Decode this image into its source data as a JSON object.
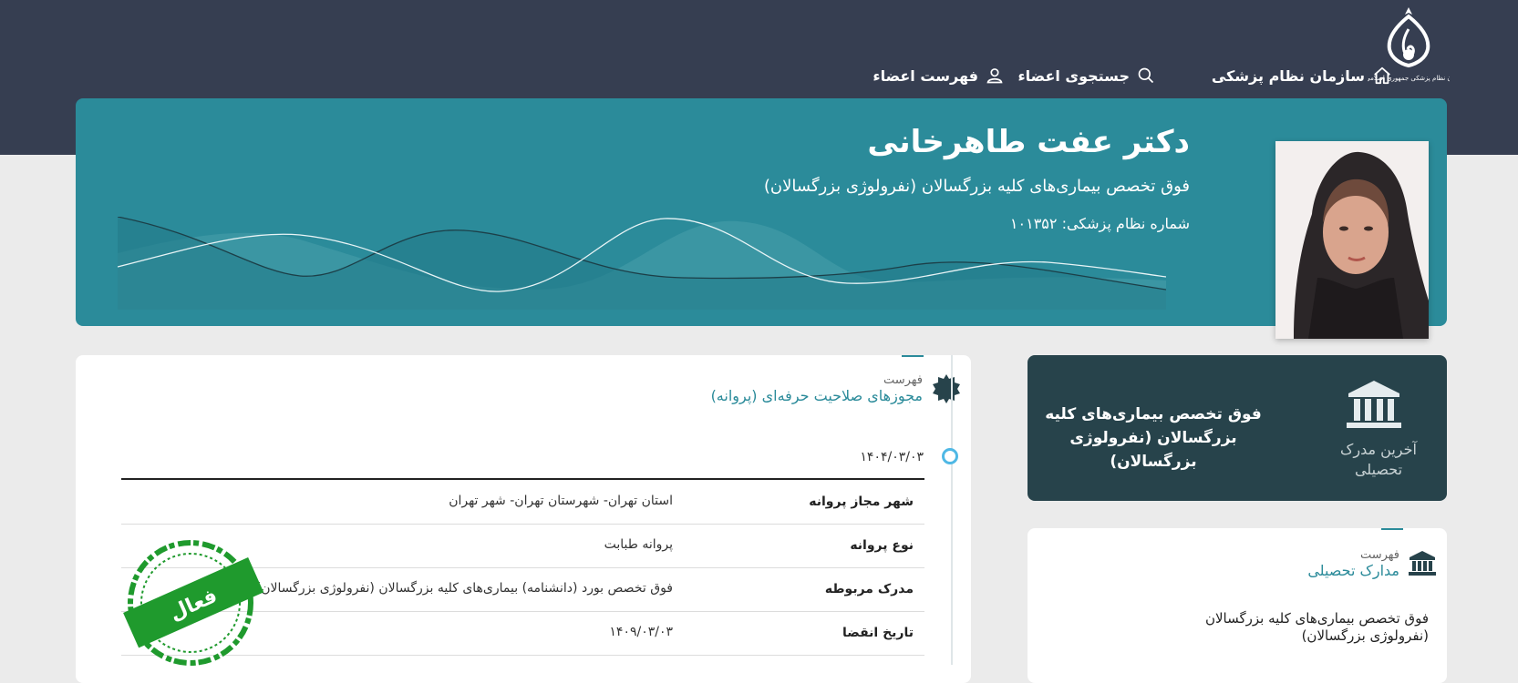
{
  "nav": {
    "home_label": "سازمان نظام پزشکی",
    "search_label": "جستجوی اعضاء",
    "members_label": "فهرست اعضاء",
    "logo_caption": "سازمان نظام پزشکی جمهوری اسلامی ایران"
  },
  "profile": {
    "name": "دکتر عفت طاهرخانی",
    "specialty": "فوق تخصص بیماری‌های کلیه بزرگسالان (نفرولوژی بزرگسالان)",
    "license_number_label": "شماره نظام پزشکی: ۱۰۱۳۵۲"
  },
  "latest_degree": {
    "label": "آخرین مدرک تحصیلی",
    "value": "فوق تخصص بیماری‌های کلیه بزرگسالان (نفرولوژی بزرگسالان)"
  },
  "license_section": {
    "small_title": "فهرست",
    "title": "مجوزهای صلاحیت حرفه‌ای (پروانه)",
    "date": "۱۴۰۴/۰۳/۰۳",
    "rows": [
      {
        "label": "شهر مجاز پروانه",
        "value": "استان تهران- شهرستان تهران- شهر تهران"
      },
      {
        "label": "نوع پروانه",
        "value": "پروانه طبابت"
      },
      {
        "label": "مدرک مربوطه",
        "value": "فوق تخصص بورد (دانشنامه) بیماری‌های کلیه بزرگسالان (نفرولوژی بزرگسالان)"
      },
      {
        "label": "تاریخ انقضا",
        "value": "۱۴۰۹/۰۳/۰۳"
      }
    ],
    "stamp_text": "فعال"
  },
  "education_section": {
    "small_title": "فهرست",
    "title": "مدارک تحصیلی",
    "items": [
      "فوق تخصص بیماری‌های کلیه بزرگسالان (نفرولوژی بزرگسالان)"
    ]
  },
  "colors": {
    "topbar": "#363e51",
    "hero": "#2b8b9a",
    "dark_card": "#27434b",
    "stamp_green": "#1f9a2d"
  }
}
